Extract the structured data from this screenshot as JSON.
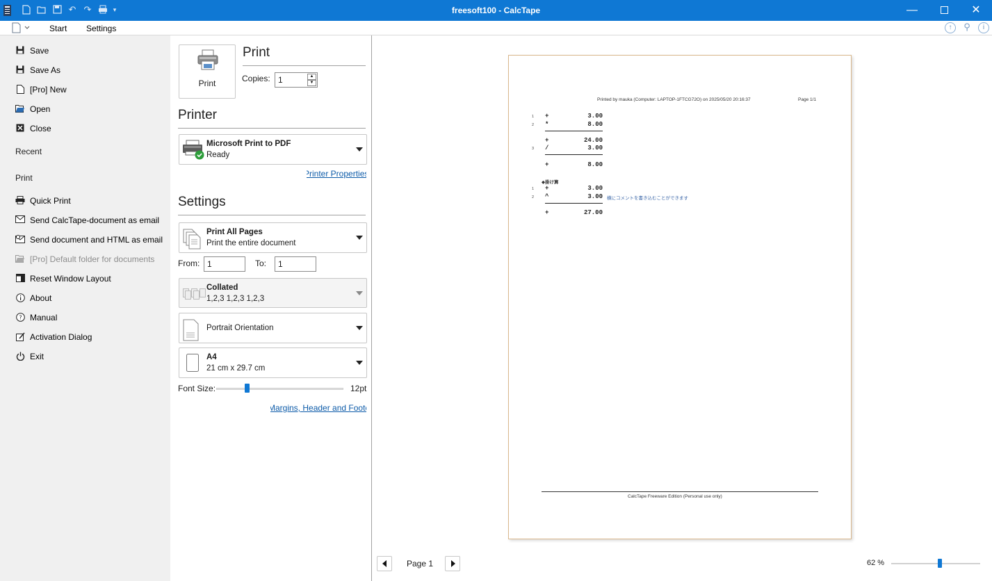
{
  "window": {
    "title": "freesoft100 - CalcTape",
    "accent": "#0f78d4"
  },
  "ribbon": {
    "tabs": [
      "Start",
      "Settings"
    ]
  },
  "backstage": {
    "items_top": [
      {
        "label": "Save",
        "icon": "save-icon"
      },
      {
        "label": "Save As",
        "icon": "save-as-icon"
      },
      {
        "label": "[Pro] New",
        "icon": "new-document-icon"
      },
      {
        "label": "Open",
        "icon": "open-folder-icon"
      },
      {
        "label": "Close",
        "icon": "close-document-icon"
      }
    ],
    "recent_header": "Recent",
    "print_header": "Print",
    "items_bottom": [
      {
        "label": "Quick Print",
        "icon": "printer-icon"
      },
      {
        "label": "Send CalcTape-document as email",
        "icon": "email-icon"
      },
      {
        "label": "Send document and HTML as email",
        "icon": "email-html-icon"
      },
      {
        "label": "[Pro] Default folder for documents",
        "icon": "folder-icon",
        "disabled": true
      },
      {
        "label": "Reset Window Layout",
        "icon": "window-layout-icon"
      },
      {
        "label": "About",
        "icon": "info-icon"
      },
      {
        "label": "Manual",
        "icon": "help-icon"
      },
      {
        "label": "Activation Dialog",
        "icon": "activation-icon"
      },
      {
        "label": "Exit",
        "icon": "power-icon"
      }
    ]
  },
  "print": {
    "heading": "Print",
    "button_label": "Print",
    "copies_label": "Copies:",
    "copies_value": "1"
  },
  "printer": {
    "heading": "Printer",
    "name": "Microsoft Print to PDF",
    "status": "Ready",
    "properties_link": "Printer Properties"
  },
  "settings": {
    "heading": "Settings",
    "pages_title": "Print All Pages",
    "pages_desc": "Print the entire document",
    "from_label": "From:",
    "from_value": "1",
    "to_label": "To:",
    "to_value": "1",
    "collated_title": "Collated",
    "collated_desc": "1,2,3  1,2,3  1,2,3",
    "orientation": "Portrait Orientation",
    "paper_title": "A4",
    "paper_desc": "21 cm x 29.7 cm",
    "font_size_label": "Font Size:",
    "font_size_value": "12pt",
    "font_size_level_percent": 24,
    "margins_link": "Margins, Header and Footer"
  },
  "preview": {
    "header": "Printed by mauka (Computer: LAPTOP-1FTCG72O) on 2025/05/20 20:16:37",
    "page_label": "Page 1/1",
    "footer": "CalcTape Freeware Edition (Personal use only)",
    "tape1": [
      {
        "n": "1",
        "op": "+",
        "val": "3.00"
      },
      {
        "n": "2",
        "op": "*",
        "val": "8.00"
      },
      {
        "n": "",
        "op": "+",
        "val": "24.00"
      },
      {
        "n": "3",
        "op": "/",
        "val": "3.00"
      },
      {
        "n": "",
        "op": "+",
        "val": "8.00"
      }
    ],
    "tape2_title": "◆掛け算",
    "tape2": [
      {
        "n": "1",
        "op": "+",
        "val": "3.00"
      },
      {
        "n": "2",
        "op": "^",
        "val": "3.00",
        "comment": "横にコメントを書き込むことができます"
      },
      {
        "n": "",
        "op": "+",
        "val": "27.00"
      }
    ],
    "nav_page": "Page 1",
    "zoom": "62 %",
    "zoom_level_percent": 55
  }
}
